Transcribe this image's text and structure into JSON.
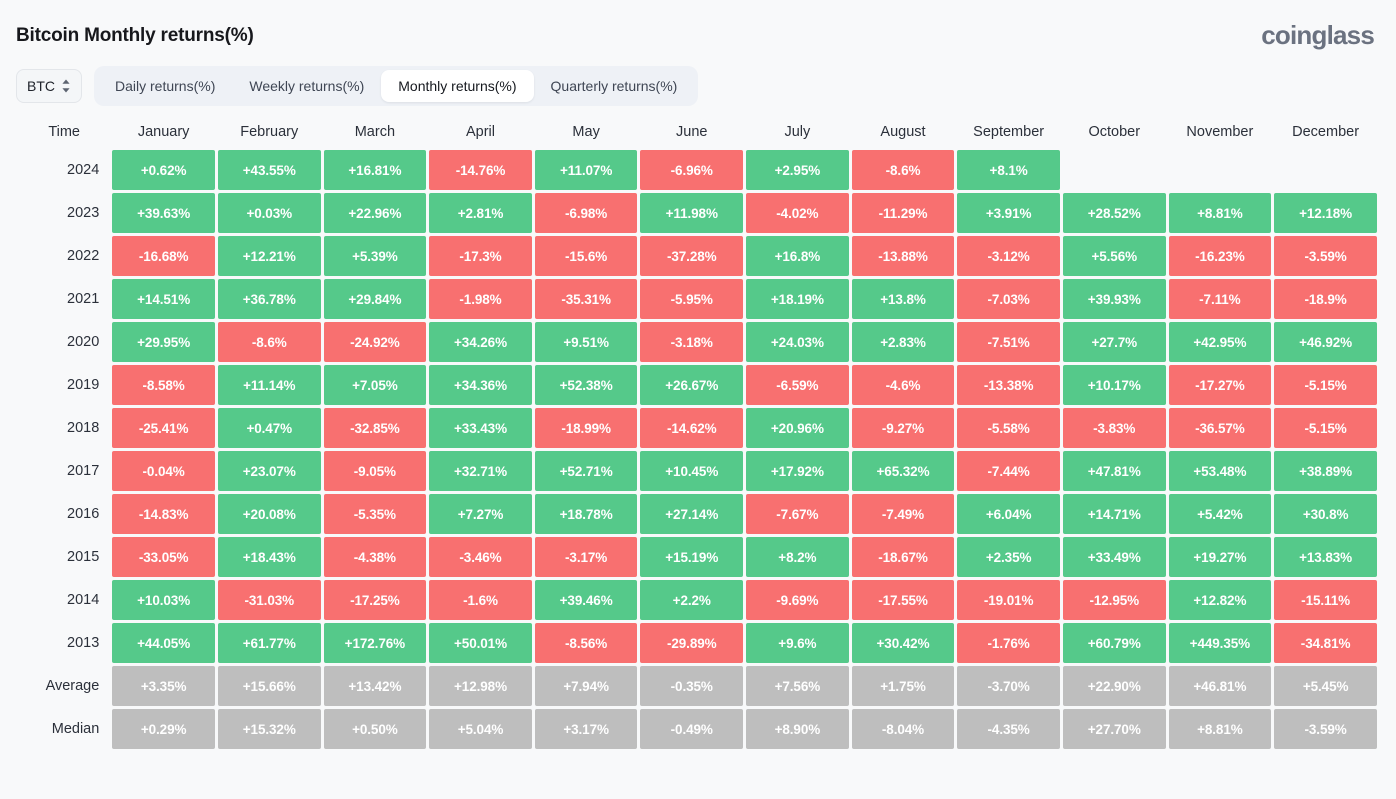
{
  "header": {
    "title": "Bitcoin Monthly returns(%)",
    "brand": "coinglass"
  },
  "controls": {
    "coin_selector": {
      "label": "BTC",
      "icon": "updown-chevron-icon"
    },
    "tabs": [
      {
        "label": "Daily returns(%)",
        "active": false
      },
      {
        "label": "Weekly returns(%)",
        "active": false
      },
      {
        "label": "Monthly returns(%)",
        "active": true
      },
      {
        "label": "Quarterly returns(%)",
        "active": false
      }
    ]
  },
  "colors": {
    "positive": "#55c98a",
    "negative": "#f87070",
    "neutral": "#bebebe",
    "background": "#f8f9fa"
  },
  "chart_data": {
    "type": "heatmap",
    "title": "Bitcoin Monthly returns(%)",
    "xlabel": "",
    "ylabel": "Time",
    "grid": false,
    "legend": "none",
    "columns": [
      "Time",
      "January",
      "February",
      "March",
      "April",
      "May",
      "June",
      "July",
      "August",
      "September",
      "October",
      "November",
      "December"
    ],
    "categories": [
      "January",
      "February",
      "March",
      "April",
      "May",
      "June",
      "July",
      "August",
      "September",
      "October",
      "November",
      "December"
    ],
    "rows": [
      {
        "label": "2024",
        "kind": "year",
        "values": [
          "+0.62%",
          "+43.55%",
          "+16.81%",
          "-14.76%",
          "+11.07%",
          "-6.96%",
          "+2.95%",
          "-8.6%",
          "+8.1%",
          "",
          "",
          ""
        ]
      },
      {
        "label": "2023",
        "kind": "year",
        "values": [
          "+39.63%",
          "+0.03%",
          "+22.96%",
          "+2.81%",
          "-6.98%",
          "+11.98%",
          "-4.02%",
          "-11.29%",
          "+3.91%",
          "+28.52%",
          "+8.81%",
          "+12.18%"
        ]
      },
      {
        "label": "2022",
        "kind": "year",
        "values": [
          "-16.68%",
          "+12.21%",
          "+5.39%",
          "-17.3%",
          "-15.6%",
          "-37.28%",
          "+16.8%",
          "-13.88%",
          "-3.12%",
          "+5.56%",
          "-16.23%",
          "-3.59%"
        ]
      },
      {
        "label": "2021",
        "kind": "year",
        "values": [
          "+14.51%",
          "+36.78%",
          "+29.84%",
          "-1.98%",
          "-35.31%",
          "-5.95%",
          "+18.19%",
          "+13.8%",
          "-7.03%",
          "+39.93%",
          "-7.11%",
          "-18.9%"
        ]
      },
      {
        "label": "2020",
        "kind": "year",
        "values": [
          "+29.95%",
          "-8.6%",
          "-24.92%",
          "+34.26%",
          "+9.51%",
          "-3.18%",
          "+24.03%",
          "+2.83%",
          "-7.51%",
          "+27.7%",
          "+42.95%",
          "+46.92%"
        ]
      },
      {
        "label": "2019",
        "kind": "year",
        "values": [
          "-8.58%",
          "+11.14%",
          "+7.05%",
          "+34.36%",
          "+52.38%",
          "+26.67%",
          "-6.59%",
          "-4.6%",
          "-13.38%",
          "+10.17%",
          "-17.27%",
          "-5.15%"
        ]
      },
      {
        "label": "2018",
        "kind": "year",
        "values": [
          "-25.41%",
          "+0.47%",
          "-32.85%",
          "+33.43%",
          "-18.99%",
          "-14.62%",
          "+20.96%",
          "-9.27%",
          "-5.58%",
          "-3.83%",
          "-36.57%",
          "-5.15%"
        ]
      },
      {
        "label": "2017",
        "kind": "year",
        "values": [
          "-0.04%",
          "+23.07%",
          "-9.05%",
          "+32.71%",
          "+52.71%",
          "+10.45%",
          "+17.92%",
          "+65.32%",
          "-7.44%",
          "+47.81%",
          "+53.48%",
          "+38.89%"
        ]
      },
      {
        "label": "2016",
        "kind": "year",
        "values": [
          "-14.83%",
          "+20.08%",
          "-5.35%",
          "+7.27%",
          "+18.78%",
          "+27.14%",
          "-7.67%",
          "-7.49%",
          "+6.04%",
          "+14.71%",
          "+5.42%",
          "+30.8%"
        ]
      },
      {
        "label": "2015",
        "kind": "year",
        "values": [
          "-33.05%",
          "+18.43%",
          "-4.38%",
          "-3.46%",
          "-3.17%",
          "+15.19%",
          "+8.2%",
          "-18.67%",
          "+2.35%",
          "+33.49%",
          "+19.27%",
          "+13.83%"
        ]
      },
      {
        "label": "2014",
        "kind": "year",
        "values": [
          "+10.03%",
          "-31.03%",
          "-17.25%",
          "-1.6%",
          "+39.46%",
          "+2.2%",
          "-9.69%",
          "-17.55%",
          "-19.01%",
          "-12.95%",
          "+12.82%",
          "-15.11%"
        ]
      },
      {
        "label": "2013",
        "kind": "year",
        "values": [
          "+44.05%",
          "+61.77%",
          "+172.76%",
          "+50.01%",
          "-8.56%",
          "-29.89%",
          "+9.6%",
          "+30.42%",
          "-1.76%",
          "+60.79%",
          "+449.35%",
          "-34.81%"
        ]
      },
      {
        "label": "Average",
        "kind": "summary",
        "values": [
          "+3.35%",
          "+15.66%",
          "+13.42%",
          "+12.98%",
          "+7.94%",
          "-0.35%",
          "+7.56%",
          "+1.75%",
          "-3.70%",
          "+22.90%",
          "+46.81%",
          "+5.45%"
        ]
      },
      {
        "label": "Median",
        "kind": "summary",
        "values": [
          "+0.29%",
          "+15.32%",
          "+0.50%",
          "+5.04%",
          "+3.17%",
          "-0.49%",
          "+8.90%",
          "-8.04%",
          "-4.35%",
          "+27.70%",
          "+8.81%",
          "-3.59%"
        ]
      }
    ]
  }
}
